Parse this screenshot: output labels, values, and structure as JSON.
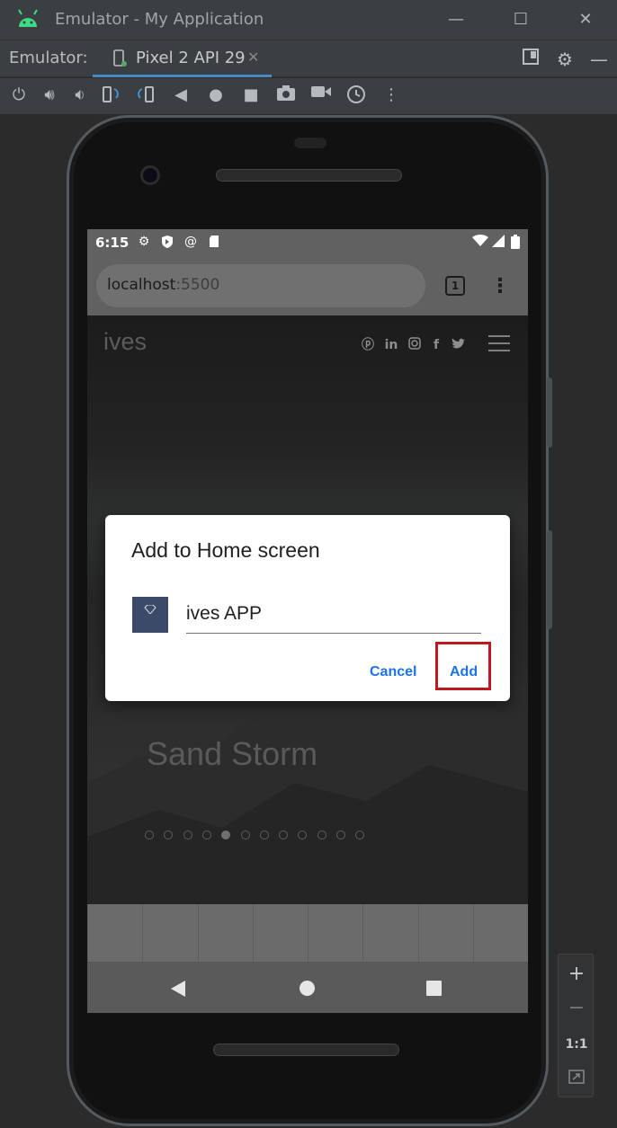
{
  "window": {
    "title": "Emulator - My Application",
    "minimize": "—",
    "maximize": "☐",
    "close": "✕"
  },
  "tabbar": {
    "label": "Emulator:",
    "tab_label": "Pixel 2 API 29",
    "tab_close": "✕"
  },
  "toolbar": {
    "buttons": [
      "power-icon",
      "volume-up-icon",
      "volume-down-icon",
      "rotate-left-icon",
      "rotate-right-icon",
      "back-icon",
      "home-icon",
      "overview-icon",
      "screenshot-icon",
      "screen-record-icon",
      "snapshot-icon",
      "more-icon"
    ]
  },
  "status": {
    "time": "6:15"
  },
  "browser": {
    "host": "localhost",
    "port": ":5500",
    "tab_count": "1"
  },
  "page": {
    "logo": "ives",
    "caption": "Sand Storm",
    "slide_count": 12,
    "active_slide": 5,
    "social": [
      "pinterest-icon",
      "linkedin-icon",
      "instagram-icon",
      "facebook-icon",
      "twitter-icon"
    ]
  },
  "dialog": {
    "title": "Add to Home screen",
    "app_name": "ives APP",
    "cancel": "Cancel",
    "add": "Add"
  },
  "zoom": {
    "zoom_in": "+",
    "zoom_out": "−",
    "actual_size": "1:1"
  },
  "colors": {
    "accent": "#1a73e8",
    "highlight": "#c0161d",
    "android_green": "#3ddc84"
  }
}
